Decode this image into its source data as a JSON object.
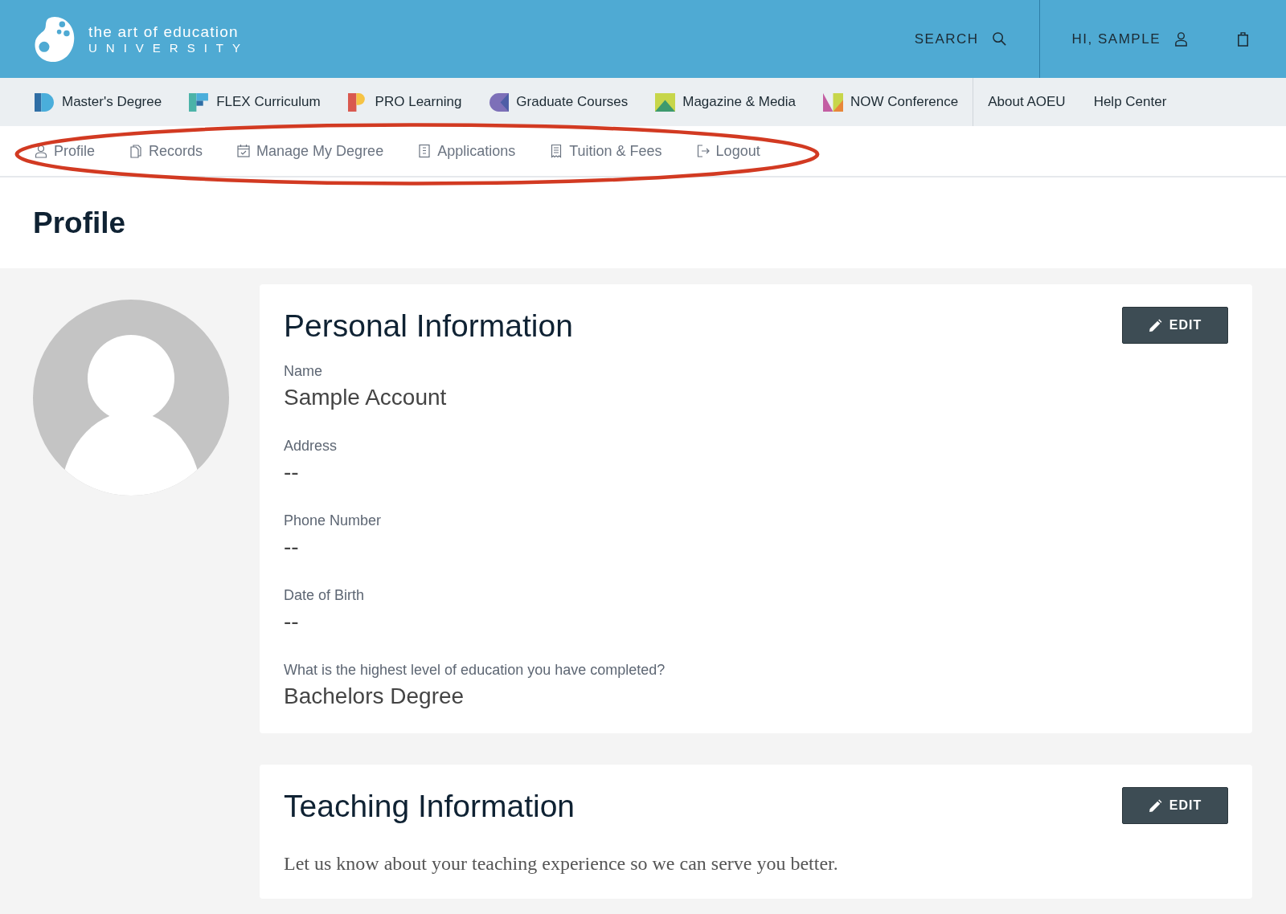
{
  "brand": {
    "line1": "the art of education",
    "line2": "UNIVERSITY"
  },
  "header": {
    "search": "SEARCH",
    "greeting": "HI, SAMPLE"
  },
  "main_nav": [
    {
      "label": "Master's Degree"
    },
    {
      "label": "FLEX Curriculum"
    },
    {
      "label": "PRO Learning"
    },
    {
      "label": "Graduate Courses"
    },
    {
      "label": "Magazine & Media"
    },
    {
      "label": "NOW Conference"
    }
  ],
  "secondary_nav": [
    "About AOEU",
    "Help Center"
  ],
  "account_nav": [
    {
      "label": "Profile"
    },
    {
      "label": "Records"
    },
    {
      "label": "Manage My Degree"
    },
    {
      "label": "Applications"
    },
    {
      "label": "Tuition & Fees"
    },
    {
      "label": "Logout"
    }
  ],
  "page_title": "Profile",
  "personal": {
    "title": "Personal Information",
    "edit": "EDIT",
    "fields": [
      {
        "label": "Name",
        "value": "Sample Account"
      },
      {
        "label": "Address",
        "value": "--"
      },
      {
        "label": "Phone Number",
        "value": "--"
      },
      {
        "label": "Date of Birth",
        "value": "--"
      },
      {
        "label": "What is the highest level of education you have completed?",
        "value": "Bachelors Degree"
      }
    ]
  },
  "teaching": {
    "title": "Teaching Information",
    "edit": "EDIT",
    "text": "Let us know about your teaching experience so we can serve you better."
  }
}
